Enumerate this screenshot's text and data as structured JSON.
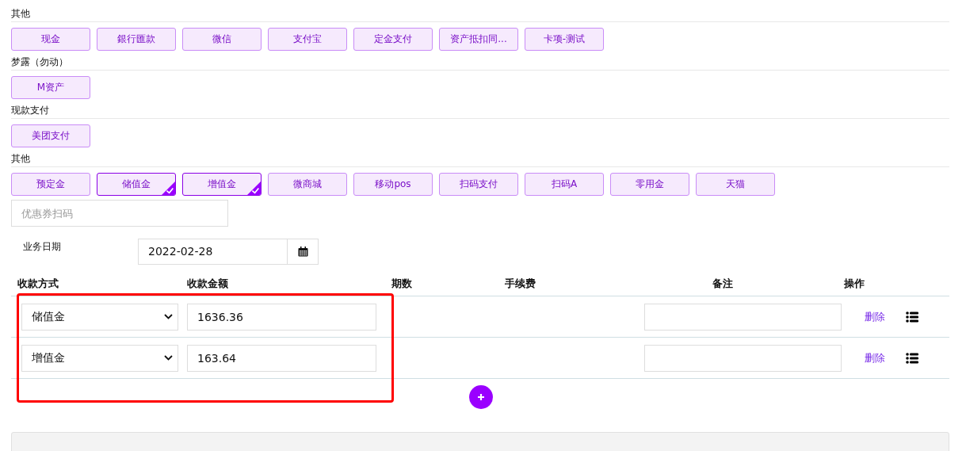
{
  "sections": [
    {
      "title": "其他",
      "buttons": [
        {
          "label": "现金",
          "selected": false
        },
        {
          "label": "銀行匯款",
          "selected": false
        },
        {
          "label": "微信",
          "selected": false
        },
        {
          "label": "支付宝",
          "selected": false
        },
        {
          "label": "定金支付",
          "selected": false
        },
        {
          "label": "资产抵扣同...",
          "selected": false
        },
        {
          "label": "卡项-测试",
          "selected": false
        }
      ]
    },
    {
      "title": "梦露（勿动）",
      "buttons": [
        {
          "label": "M资产",
          "selected": false
        }
      ]
    },
    {
      "title": "现款支付",
      "buttons": [
        {
          "label": "美团支付",
          "selected": false
        }
      ]
    },
    {
      "title": "其他",
      "buttons": [
        {
          "label": "预定金",
          "selected": false
        },
        {
          "label": "储值金",
          "selected": true
        },
        {
          "label": "增值金",
          "selected": true
        },
        {
          "label": "微商城",
          "selected": false
        },
        {
          "label": "移动pos",
          "selected": false
        },
        {
          "label": "扫码支付",
          "selected": false
        },
        {
          "label": "扫码A",
          "selected": false
        },
        {
          "label": "零用金",
          "selected": false
        },
        {
          "label": "天猫",
          "selected": false
        }
      ]
    }
  ],
  "coupon": {
    "placeholder": "优惠券扫码"
  },
  "date": {
    "label": "业务日期",
    "value": "2022-02-28"
  },
  "table": {
    "columns": [
      "收款方式",
      "收款金额",
      "期数",
      "手续费",
      "备注",
      "操作"
    ],
    "rows": [
      {
        "method": "储值金",
        "amount": "1636.36",
        "action": "删除"
      },
      {
        "method": "增值金",
        "amount": "163.64",
        "action": "删除"
      }
    ]
  },
  "highlight": true
}
